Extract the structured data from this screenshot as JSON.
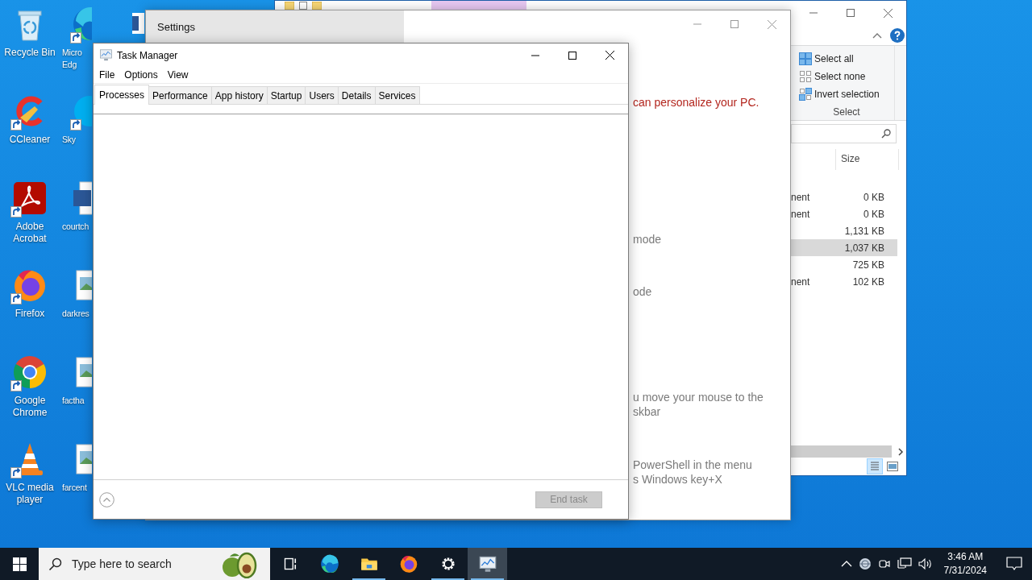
{
  "desktop_icons": [
    {
      "label": "Recycle Bin",
      "kind": "recycle_bin",
      "shortcut": false
    },
    {
      "label": "CCleaner",
      "kind": "ccleaner",
      "shortcut": true
    },
    {
      "label": "Adobe Acrobat",
      "kind": "acrobat",
      "shortcut": true
    },
    {
      "label": "Firefox",
      "kind": "firefox",
      "shortcut": true
    },
    {
      "label": "Google Chrome",
      "kind": "chrome",
      "shortcut": true
    },
    {
      "label": "VLC media player",
      "kind": "vlc",
      "shortcut": true
    }
  ],
  "desktop_icons_column_2": [
    {
      "lines": [
        "Micro",
        "Edg"
      ],
      "kind": "edge",
      "shortcut": true
    },
    {
      "lines": [
        "Sky"
      ],
      "kind": "skype",
      "shortcut": true
    },
    {
      "lines": [
        "courtch"
      ],
      "kind": "word",
      "shortcut": false
    },
    {
      "lines": [
        "darkres"
      ],
      "kind": "image",
      "shortcut": false
    },
    {
      "lines": [
        "factha"
      ],
      "kind": "image",
      "shortcut": false
    },
    {
      "lines": [
        "farcent"
      ],
      "kind": "image",
      "shortcut": false
    }
  ],
  "explorer": {
    "ribbon_commands": [
      {
        "label": "Select all",
        "kind": "select_all"
      },
      {
        "label": "Select none",
        "kind": "select_none"
      },
      {
        "label": "Invert selection",
        "kind": "invert"
      }
    ],
    "ribbon_group": "Select",
    "column_header": "Size",
    "rows": [
      {
        "type": "nent",
        "size": "0 KB",
        "selected": false
      },
      {
        "type": "nent",
        "size": "0 KB",
        "selected": false
      },
      {
        "size": "1,131 KB",
        "selected": false
      },
      {
        "size": "1,037 KB",
        "selected": true
      },
      {
        "size": "725 KB",
        "selected": false
      },
      {
        "type": "nent",
        "size": "102 KB",
        "selected": false
      }
    ]
  },
  "settings": {
    "title": "Settings",
    "texts": [
      {
        "lines": [
          "can personalize your PC."
        ],
        "kind": "accent"
      },
      {
        "lines": [
          "mode"
        ],
        "kind": "plain"
      },
      {
        "lines": [
          "ode"
        ],
        "kind": "plain"
      },
      {
        "lines": [
          "u move your mouse to the",
          "skbar"
        ],
        "kind": "plain"
      },
      {
        "lines": [
          "PowerShell in the menu",
          "s Windows key+X"
        ],
        "kind": "plain"
      }
    ]
  },
  "task_manager": {
    "title": "Task Manager",
    "menu": [
      "File",
      "Options",
      "View"
    ],
    "tabs": [
      {
        "label": "Processes",
        "selected": true
      },
      {
        "label": "Performance",
        "selected": false
      },
      {
        "label": "App history",
        "selected": false
      },
      {
        "label": "Startup",
        "selected": false
      },
      {
        "label": "Users",
        "selected": false
      },
      {
        "label": "Details",
        "selected": false
      },
      {
        "label": "Services",
        "selected": false
      }
    ],
    "end_task": {
      "label": "End task",
      "disabled": true
    }
  },
  "taskbar": {
    "search": {
      "placeholder": "Type here to search"
    },
    "apps": [
      {
        "kind": "task_view",
        "running": false,
        "active": false
      },
      {
        "kind": "edge",
        "running": false,
        "active": false
      },
      {
        "kind": "explorer",
        "running": true,
        "active": false
      },
      {
        "kind": "firefox",
        "running": false,
        "active": false
      },
      {
        "kind": "settings",
        "running": true,
        "active": false
      },
      {
        "kind": "task_manager",
        "running": true,
        "active": true
      }
    ],
    "clock": {
      "time": "3:46 AM",
      "date": "7/31/2024"
    }
  }
}
